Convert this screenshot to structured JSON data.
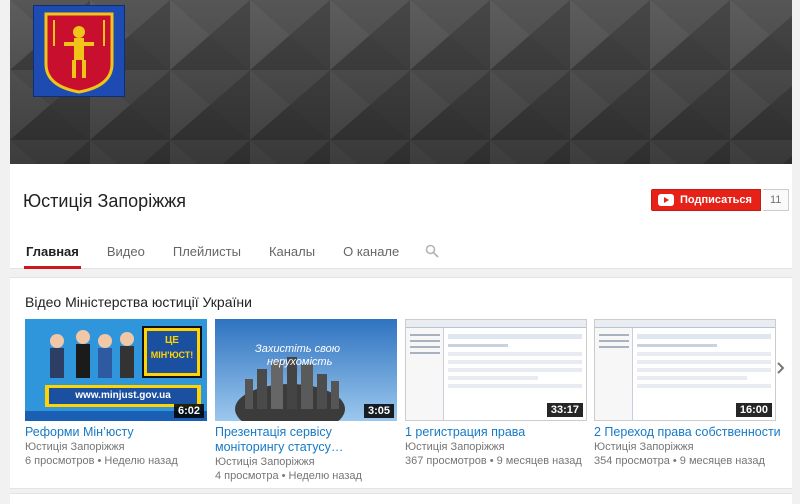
{
  "channel": {
    "title": "Юстиція Запоріжжя",
    "subscribe_label": "Подписаться",
    "subscriber_count": "11"
  },
  "tabs": [
    {
      "label": "Главная",
      "active": true
    },
    {
      "label": "Видео",
      "active": false
    },
    {
      "label": "Плейлисты",
      "active": false
    },
    {
      "label": "Каналы",
      "active": false
    },
    {
      "label": "О канале",
      "active": false
    }
  ],
  "section": {
    "title": "Відео Міністерства юстиції України"
  },
  "videos": [
    {
      "title_line1": "Реформи Мін’юсту",
      "title_line2": "",
      "duration": "6:02",
      "channel": "Юстиція Запоріжжя",
      "meta": "6 просмотров • Неделю назад",
      "thumb_text_top": "ЦЕ",
      "thumb_text_mid": "МІН'ЮСТ!",
      "thumb_url": "www.minjust.gov.ua"
    },
    {
      "title_line1": "Презентація сервісу",
      "title_line2": "моніторингу статусу…",
      "duration": "3:05",
      "channel": "Юстиція Запоріжжя",
      "meta": "4 просмотра • Неделю назад",
      "thumb_text_top": "Захистіть свою",
      "thumb_text_mid": "нерухомість"
    },
    {
      "title_line1": "1 регистрация права",
      "title_line2": "",
      "duration": "33:17",
      "channel": "Юстиція Запоріжжя",
      "meta": "367 просмотров • 9 месяцев назад"
    },
    {
      "title_line1": "2 Переход права собственности",
      "title_line2": "",
      "duration": "16:00",
      "channel": "Юстиція Запоріжжя",
      "meta": "354 просмотра • 9 месяцев назад"
    }
  ],
  "colors": {
    "accent": "#cc181e",
    "subscribe": "#e62117",
    "link": "#167ac6"
  }
}
